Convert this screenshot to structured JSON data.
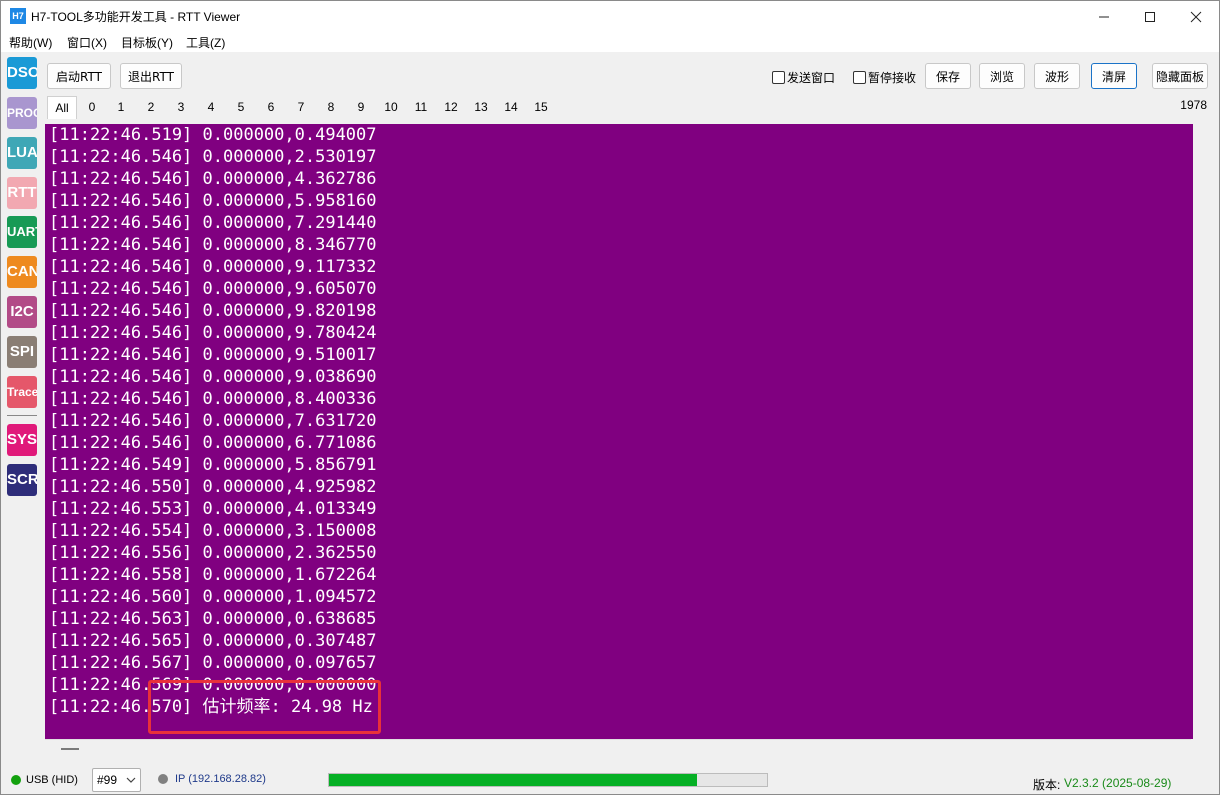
{
  "window": {
    "icon_text": "H7",
    "title": "H7-TOOL多功能开发工具 - RTT Viewer",
    "minimize_icon": "minimize-icon",
    "maximize_icon": "maximize-icon",
    "close_icon": "close-icon"
  },
  "menu": [
    {
      "label": "帮助(W)"
    },
    {
      "label": "窗口(X)"
    },
    {
      "label": "目标板(Y)"
    },
    {
      "label": "工具(Z)"
    }
  ],
  "sidebar": [
    {
      "label": "DSO",
      "color": "#1a9ad6"
    },
    {
      "label": "PROG",
      "color": "#a996cf"
    },
    {
      "label": "LUA",
      "color": "#3fa7b6"
    },
    {
      "label": "RTT",
      "color": "#f2a8b1"
    },
    {
      "label": "UART",
      "color": "#179a55"
    },
    {
      "label": "CAN",
      "color": "#ee8a1f"
    },
    {
      "label": "I2C",
      "color": "#b24b87"
    },
    {
      "label": "SPI",
      "color": "#8a7e74"
    },
    {
      "label": "Trace",
      "color": "#e5576a"
    },
    {
      "label": "SYS",
      "color": "#e0197a"
    },
    {
      "label": "SCR",
      "color": "#2e2d7a"
    }
  ],
  "toolbar": {
    "start_rtt": "启动RTT",
    "exit_rtt": "退出RTT",
    "send_window": "发送窗口",
    "send_window_checked": false,
    "pause_receive": "暂停接收",
    "pause_receive_checked": false,
    "save": "保存",
    "browse": "浏览",
    "waveform": "波形",
    "clear": "清屏",
    "hide_panel": "隐藏面板"
  },
  "tabs": [
    "All",
    "0",
    "1",
    "2",
    "3",
    "4",
    "5",
    "6",
    "7",
    "8",
    "9",
    "10",
    "11",
    "12",
    "13",
    "14",
    "15"
  ],
  "line_count": "1978",
  "log": {
    "background": "#800080",
    "lines": [
      "[11:22:46.519] 0.000000,0.494007",
      "[11:22:46.546] 0.000000,2.530197",
      "[11:22:46.546] 0.000000,4.362786",
      "[11:22:46.546] 0.000000,5.958160",
      "[11:22:46.546] 0.000000,7.291440",
      "[11:22:46.546] 0.000000,8.346770",
      "[11:22:46.546] 0.000000,9.117332",
      "[11:22:46.546] 0.000000,9.605070",
      "[11:22:46.546] 0.000000,9.820198",
      "[11:22:46.546] 0.000000,9.780424",
      "[11:22:46.546] 0.000000,9.510017",
      "[11:22:46.546] 0.000000,9.038690",
      "[11:22:46.546] 0.000000,8.400336",
      "[11:22:46.546] 0.000000,7.631720",
      "[11:22:46.546] 0.000000,6.771086",
      "[11:22:46.549] 0.000000,5.856791",
      "[11:22:46.550] 0.000000,4.925982",
      "[11:22:46.553] 0.000000,4.013349",
      "[11:22:46.554] 0.000000,3.150008",
      "[11:22:46.556] 0.000000,2.362550",
      "[11:22:46.558] 0.000000,1.672264",
      "[11:22:46.560] 0.000000,1.094572",
      "[11:22:46.563] 0.000000,0.638685",
      "[11:22:46.565] 0.000000,0.307487",
      "[11:22:46.567] 0.000000,0.097657",
      "[11:22:46.569] 0.000000,0.000000",
      "[11:22:46.570] 估计频率: 24.98 Hz"
    ],
    "highlight_color": "#e8313a"
  },
  "status": {
    "usb_label": "USB (HID)",
    "usb_color": "#13a10e",
    "device_select": "#99",
    "ip_label": "IP (192.168.28.82)",
    "ip_dot_color": "#808080",
    "ip_text_color": "#1f3a8a",
    "progress": 0.84,
    "progress_color": "#06b025",
    "version_label": "版本:",
    "version_value": "V2.3.2 (2025-08-29)",
    "version_color": "#1a8a1a"
  }
}
